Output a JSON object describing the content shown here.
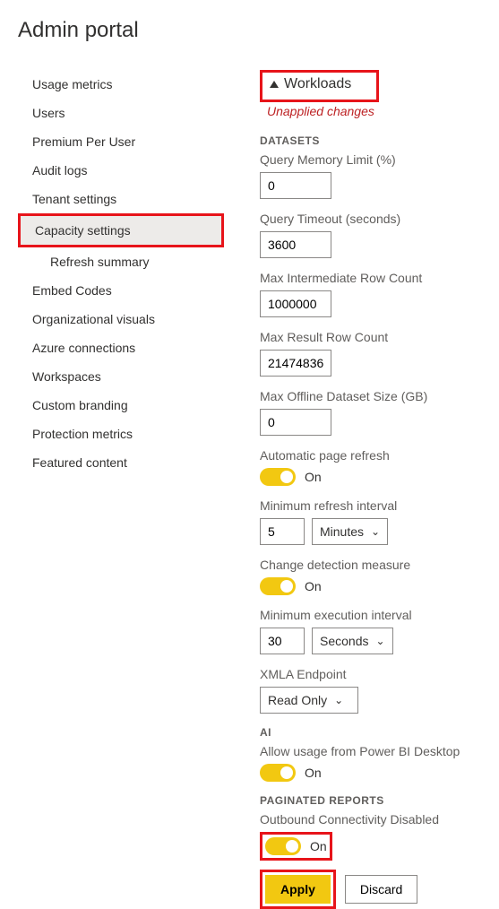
{
  "header": {
    "title": "Admin portal"
  },
  "sidebar": {
    "items": [
      {
        "label": "Usage metrics"
      },
      {
        "label": "Users"
      },
      {
        "label": "Premium Per User"
      },
      {
        "label": "Audit logs"
      },
      {
        "label": "Tenant settings"
      },
      {
        "label": "Capacity settings"
      },
      {
        "label": "Refresh summary"
      },
      {
        "label": "Embed Codes"
      },
      {
        "label": "Organizational visuals"
      },
      {
        "label": "Azure connections"
      },
      {
        "label": "Workspaces"
      },
      {
        "label": "Custom branding"
      },
      {
        "label": "Protection metrics"
      },
      {
        "label": "Featured content"
      }
    ]
  },
  "content": {
    "section_title": "Workloads",
    "unapplied": "Unapplied changes",
    "datasets": {
      "label": "DATASETS",
      "query_memory_label": "Query Memory Limit (%)",
      "query_memory_value": "0",
      "query_timeout_label": "Query Timeout (seconds)",
      "query_timeout_value": "3600",
      "max_intermediate_label": "Max Intermediate Row Count",
      "max_intermediate_value": "1000000",
      "max_result_label": "Max Result Row Count",
      "max_result_value": "21474836",
      "max_offline_label": "Max Offline Dataset Size (GB)",
      "max_offline_value": "0",
      "auto_refresh_label": "Automatic page refresh",
      "auto_refresh_state": "On",
      "min_refresh_label": "Minimum refresh interval",
      "min_refresh_value": "5",
      "min_refresh_unit": "Minutes",
      "change_detect_label": "Change detection measure",
      "change_detect_state": "On",
      "min_exec_label": "Minimum execution interval",
      "min_exec_value": "30",
      "min_exec_unit": "Seconds",
      "xmla_label": "XMLA Endpoint",
      "xmla_value": "Read Only"
    },
    "ai": {
      "label": "AI",
      "allow_desktop_label": "Allow usage from Power BI Desktop",
      "allow_desktop_state": "On"
    },
    "paginated": {
      "label": "PAGINATED REPORTS",
      "outbound_label": "Outbound Connectivity Disabled",
      "outbound_state": "On"
    },
    "buttons": {
      "apply": "Apply",
      "discard": "Discard"
    }
  }
}
